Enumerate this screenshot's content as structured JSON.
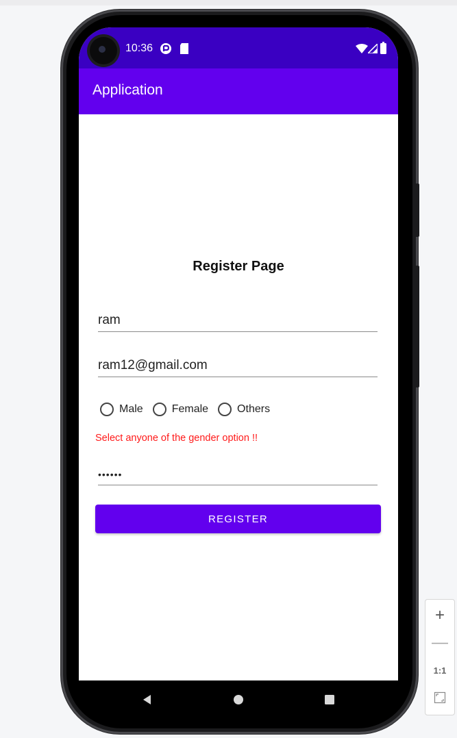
{
  "status_bar": {
    "time": "10:36",
    "icons": [
      "data-saver-icon",
      "sd-card-icon",
      "wifi-icon",
      "signal-icon",
      "battery-icon"
    ]
  },
  "app_bar": {
    "title": "Application"
  },
  "form": {
    "title": "Register Page",
    "name_value": "ram",
    "email_value": "ram12@gmail.com",
    "gender_options": [
      "Male",
      "Female",
      "Others"
    ],
    "gender_selected": null,
    "error_message": "Select anyone of the gender option !!",
    "password_mask": "••••••",
    "register_label": "REGISTER"
  },
  "nav_bar": {
    "buttons": [
      "back-icon",
      "home-icon",
      "recents-icon"
    ]
  },
  "zoom_controls": {
    "plus": "+",
    "minus": "—",
    "one_to_one": "1:1"
  },
  "colors": {
    "primary": "#6200ee",
    "primary_dark": "#3a00c2",
    "error": "#ff1a1a"
  }
}
